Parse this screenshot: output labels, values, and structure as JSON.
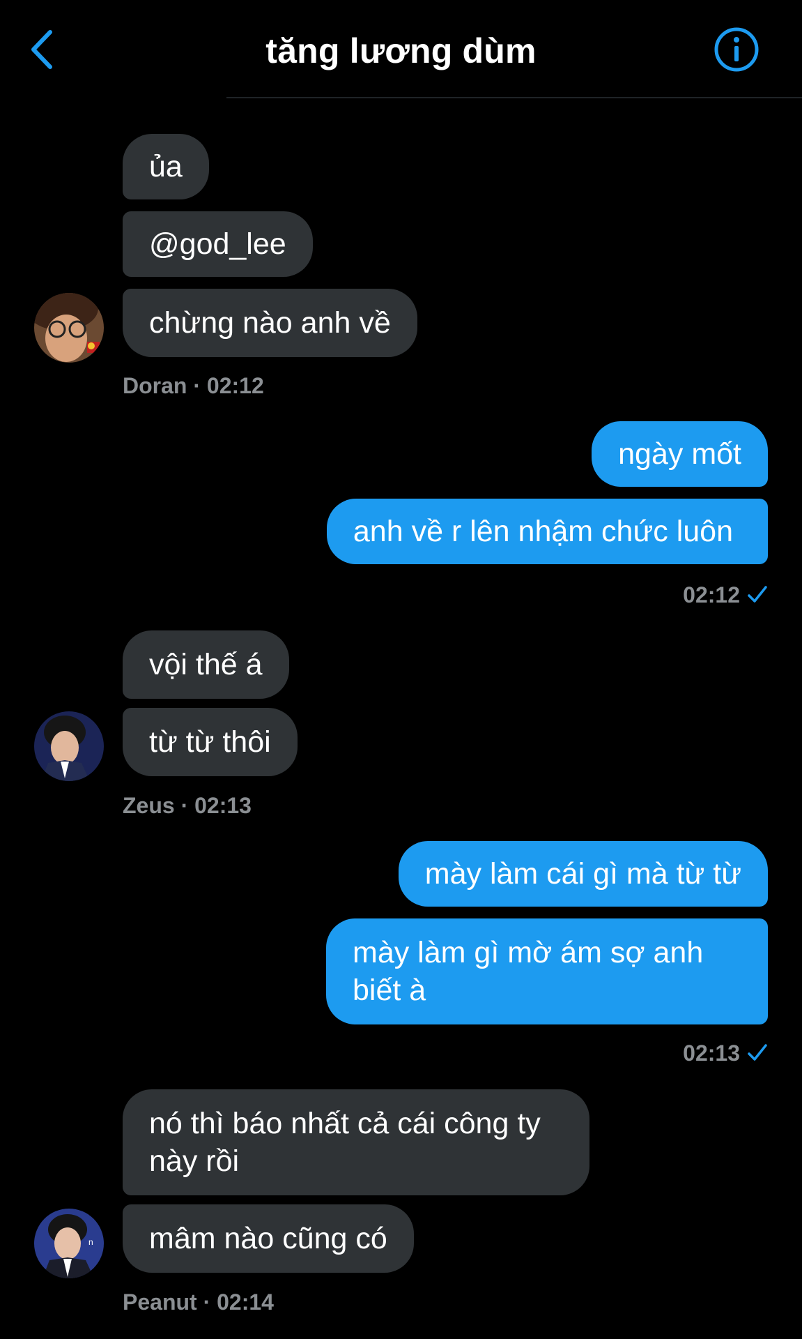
{
  "header": {
    "title": "tăng lương dùm",
    "back_icon": "chevron-left-icon",
    "info_icon": "info-circle-icon",
    "accent_color": "#1d9bf0"
  },
  "colors": {
    "incoming_bubble": "#2f3336",
    "outgoing_bubble": "#1d9bf0",
    "meta_text": "#8b8f93"
  },
  "messages": {
    "group1": {
      "bubbles": [
        "ủa",
        "@god_lee",
        "chừng nào anh về"
      ],
      "sender": "Doran",
      "time": "02:12"
    },
    "group2": {
      "bubbles": [
        "ngày mốt",
        "anh về r lên nhậm chức luôn"
      ],
      "time": "02:12"
    },
    "group3": {
      "bubbles": [
        "vội thế á",
        "từ từ thôi"
      ],
      "sender": "Zeus",
      "time": "02:13"
    },
    "group4": {
      "bubbles": [
        "mày làm cái gì mà từ từ",
        "mày làm gì mờ ám sợ anh biết à"
      ],
      "time": "02:13"
    },
    "group5": {
      "bubbles": [
        "nó thì báo nhất cả cái công ty này rồi",
        "mâm nào cũng có"
      ],
      "sender": "Peanut",
      "time": "02:14"
    },
    "separator": " · "
  }
}
